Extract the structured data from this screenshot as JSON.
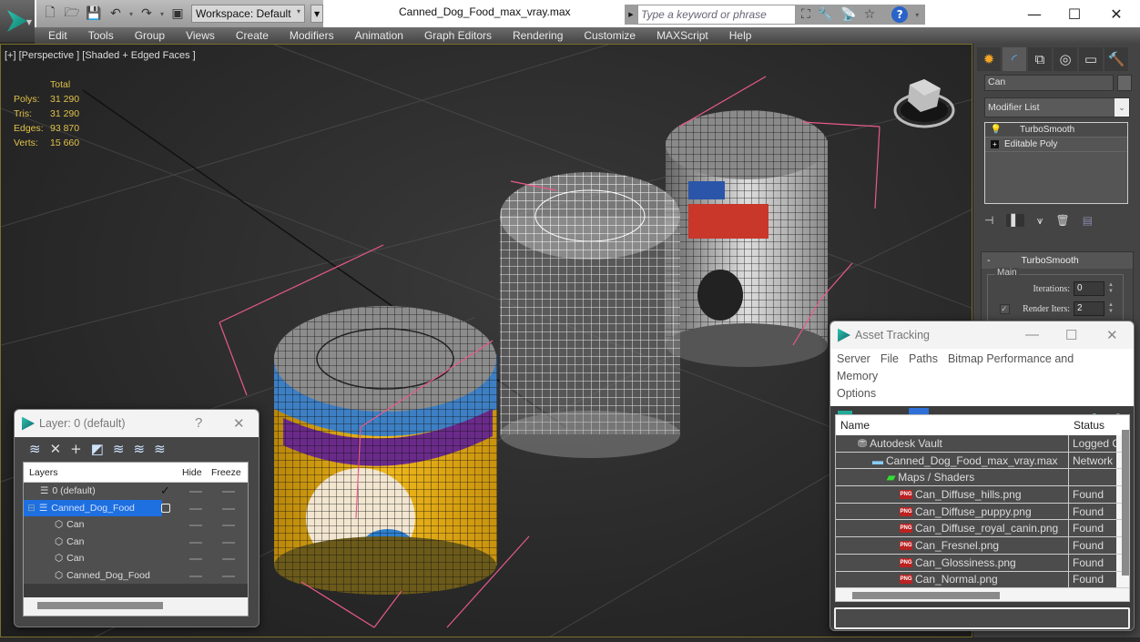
{
  "titlebar": {
    "workspace": "Workspace: Default",
    "document_title": "Canned_Dog_Food_max_vray.max",
    "search_placeholder": "Type a keyword or phrase"
  },
  "menubar": {
    "items": [
      "Edit",
      "Tools",
      "Group",
      "Views",
      "Create",
      "Modifiers",
      "Animation",
      "Graph Editors",
      "Rendering",
      "Customize",
      "MAXScript",
      "Help"
    ]
  },
  "viewport": {
    "label": "[+] [Perspective ] [Shaded + Edged Faces ]",
    "stats": {
      "header": "Total",
      "rows": [
        {
          "label": "Polys:",
          "value": "31 290"
        },
        {
          "label": "Tris:",
          "value": "31 290"
        },
        {
          "label": "Edges:",
          "value": "93 870"
        },
        {
          "label": "Verts:",
          "value": "15 660"
        }
      ]
    },
    "colors": {
      "selection_bracket": "#e85a8a",
      "stats_text": "#e0c24a"
    }
  },
  "command_panel": {
    "object_name": "Can",
    "modifier_list": "Modifier List",
    "stack": [
      {
        "name": "TurboSmooth",
        "icon": "lightbulb-icon"
      },
      {
        "name": "Editable Poly",
        "icon": "expand-plus-icon"
      }
    ],
    "turbosmooth": {
      "title": "TurboSmooth",
      "collapse": "-",
      "group": "Main",
      "iterations_label": "Iterations:",
      "iterations": "0",
      "render_iters_label": "Render Iters:",
      "render_iters": "2",
      "render_iters_checked": true
    }
  },
  "layer_dialog": {
    "title": "Layer: 0 (default)",
    "help": "?",
    "columns": [
      "Layers",
      "",
      "Hide",
      "Freeze"
    ],
    "rows": [
      {
        "name": "0 (default)",
        "indent": 1,
        "icon": "layer-icon",
        "current": true,
        "selected": false
      },
      {
        "name": "Canned_Dog_Food",
        "indent": 0,
        "icon": "layer-icon",
        "current": false,
        "selected": true
      },
      {
        "name": "Can",
        "indent": 2,
        "icon": "object-icon",
        "selected": false
      },
      {
        "name": "Can",
        "indent": 2,
        "icon": "object-icon",
        "selected": false
      },
      {
        "name": "Can",
        "indent": 2,
        "icon": "object-icon",
        "selected": false
      },
      {
        "name": "Canned_Dog_Food",
        "indent": 2,
        "icon": "object-icon",
        "selected": false
      }
    ]
  },
  "asset_dialog": {
    "title": "Asset Tracking",
    "menu": [
      "Server",
      "File",
      "Paths",
      "Bitmap Performance and Memory",
      "Options"
    ],
    "columns": [
      "Name",
      "Status"
    ],
    "rows": [
      {
        "name": "Autodesk Vault",
        "status": "Logged Out",
        "indent": 1,
        "icon": "vault-icon"
      },
      {
        "name": "Canned_Dog_Food_max_vray.max",
        "status": "Network",
        "indent": 2,
        "icon": "max-file-icon"
      },
      {
        "name": "Maps / Shaders",
        "status": "",
        "indent": 3,
        "icon": "maps-icon"
      },
      {
        "name": "Can_Diffuse_hills.png",
        "status": "Found",
        "indent": 4,
        "icon": "png-icon"
      },
      {
        "name": "Can_Diffuse_puppy.png",
        "status": "Found",
        "indent": 4,
        "icon": "png-icon"
      },
      {
        "name": "Can_Diffuse_royal_canin.png",
        "status": "Found",
        "indent": 4,
        "icon": "png-icon"
      },
      {
        "name": "Can_Fresnel.png",
        "status": "Found",
        "indent": 4,
        "icon": "png-icon"
      },
      {
        "name": "Can_Glossiness.png",
        "status": "Found",
        "indent": 4,
        "icon": "png-icon"
      },
      {
        "name": "Can_Normal.png",
        "status": "Found",
        "indent": 4,
        "icon": "png-icon"
      }
    ]
  }
}
